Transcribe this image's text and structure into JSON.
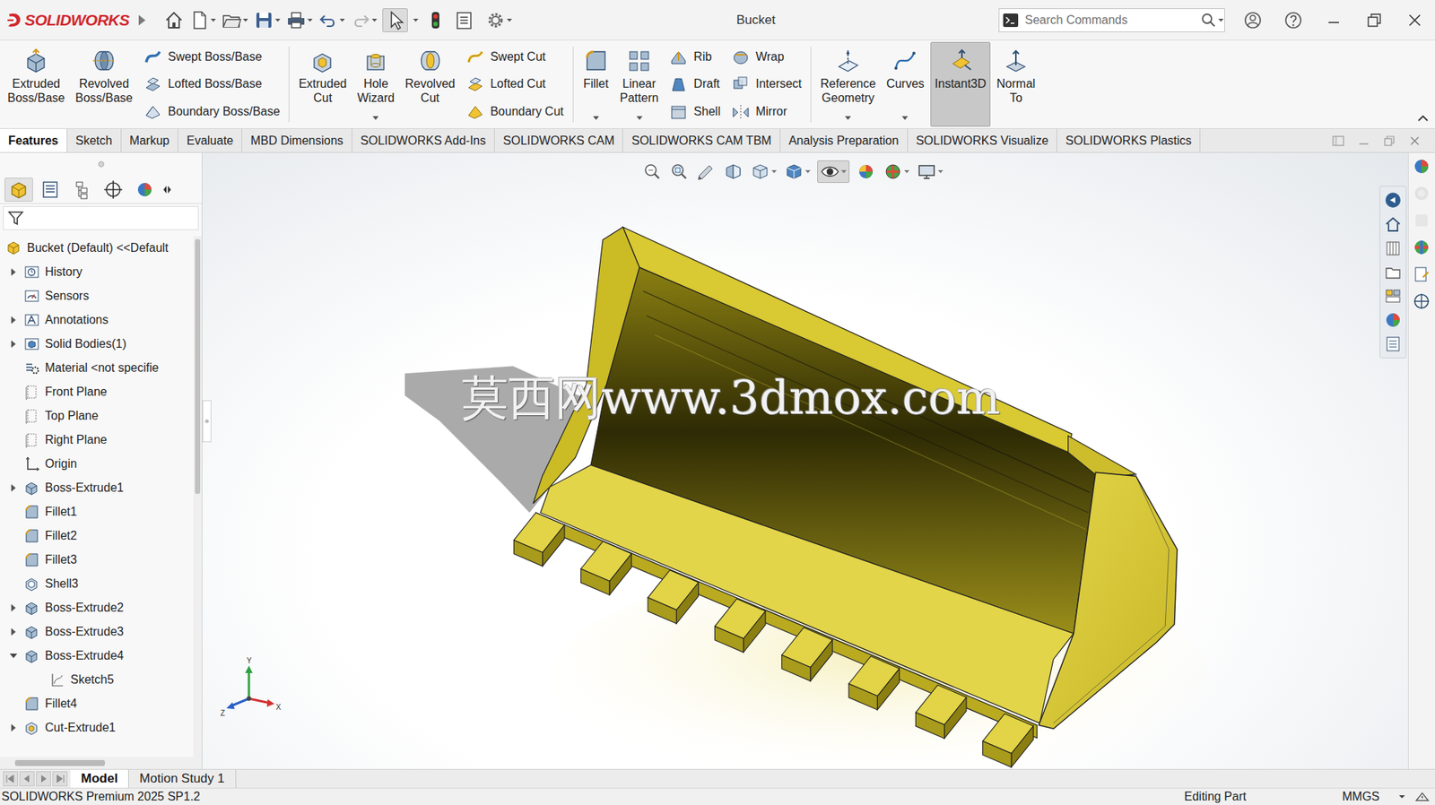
{
  "app": {
    "brand": "SOLIDWORKS"
  },
  "window": {
    "title": "Bucket"
  },
  "search": {
    "placeholder": "Search Commands"
  },
  "ribbon": {
    "groups": [
      {
        "items": [
          {
            "kind": "large",
            "label": "Extruded Boss/Base",
            "selected": false,
            "dropdown": false
          },
          {
            "kind": "large",
            "label": "Revolved Boss/Base",
            "selected": false,
            "dropdown": false
          },
          {
            "kind": "column",
            "entries": [
              "Swept Boss/Base",
              "Lofted Boss/Base",
              "Boundary Boss/Base"
            ]
          }
        ]
      },
      {
        "items": [
          {
            "kind": "large",
            "label": "Extruded Cut",
            "selected": false,
            "dropdown": false
          },
          {
            "kind": "large",
            "label": "Hole Wizard",
            "selected": false,
            "dropdown": true
          },
          {
            "kind": "large",
            "label": "Revolved Cut",
            "selected": false,
            "dropdown": false
          },
          {
            "kind": "column",
            "entries": [
              "Swept Cut",
              "Lofted Cut",
              "Boundary Cut"
            ]
          }
        ]
      },
      {
        "items": [
          {
            "kind": "large",
            "label": "Fillet",
            "selected": false,
            "dropdown": true
          },
          {
            "kind": "large",
            "label": "Linear Pattern",
            "selected": false,
            "dropdown": true
          },
          {
            "kind": "column",
            "entries": [
              "Rib",
              "Draft",
              "Shell"
            ]
          },
          {
            "kind": "column",
            "entries": [
              "Wrap",
              "Intersect",
              "Mirror"
            ]
          }
        ]
      },
      {
        "items": [
          {
            "kind": "large",
            "label": "Reference Geometry",
            "selected": false,
            "dropdown": true
          },
          {
            "kind": "large",
            "label": "Curves",
            "selected": false,
            "dropdown": true
          },
          {
            "kind": "large",
            "label": "Instant3D",
            "selected": true,
            "dropdown": false
          },
          {
            "kind": "large",
            "label": "Normal To",
            "selected": false,
            "dropdown": false
          }
        ]
      }
    ]
  },
  "tabs": [
    {
      "label": "Features",
      "selected": true
    },
    {
      "label": "Sketch",
      "selected": false
    },
    {
      "label": "Markup",
      "selected": false
    },
    {
      "label": "Evaluate",
      "selected": false
    },
    {
      "label": "MBD Dimensions",
      "selected": false
    },
    {
      "label": "SOLIDWORKS Add-Ins",
      "selected": false
    },
    {
      "label": "SOLIDWORKS CAM",
      "selected": false
    },
    {
      "label": "SOLIDWORKS CAM TBM",
      "selected": false
    },
    {
      "label": "Analysis Preparation",
      "selected": false
    },
    {
      "label": "SOLIDWORKS Visualize",
      "selected": false
    },
    {
      "label": "SOLIDWORKS Plastics",
      "selected": false
    }
  ],
  "tree": {
    "items": [
      {
        "label": "Bucket (Default) <<Default",
        "depth": 0,
        "expandable": false,
        "expanded": false,
        "kind": "part"
      },
      {
        "label": "History",
        "depth": 1,
        "expandable": true,
        "expanded": false,
        "kind": "history"
      },
      {
        "label": "Sensors",
        "depth": 1,
        "expandable": false,
        "expanded": false,
        "kind": "sensor"
      },
      {
        "label": "Annotations",
        "depth": 1,
        "expandable": true,
        "expanded": false,
        "kind": "annotation"
      },
      {
        "label": "Solid Bodies(1)",
        "depth": 1,
        "expandable": true,
        "expanded": false,
        "kind": "solid"
      },
      {
        "label": "Material <not specifie",
        "depth": 1,
        "expandable": false,
        "expanded": false,
        "kind": "material"
      },
      {
        "label": "Front Plane",
        "depth": 1,
        "expandable": false,
        "expanded": false,
        "kind": "plane"
      },
      {
        "label": "Top Plane",
        "depth": 1,
        "expandable": false,
        "expanded": false,
        "kind": "plane"
      },
      {
        "label": "Right Plane",
        "depth": 1,
        "expandable": false,
        "expanded": false,
        "kind": "plane"
      },
      {
        "label": "Origin",
        "depth": 1,
        "expandable": false,
        "expanded": false,
        "kind": "origin"
      },
      {
        "label": "Boss-Extrude1",
        "depth": 1,
        "expandable": true,
        "expanded": false,
        "kind": "extrude"
      },
      {
        "label": "Fillet1",
        "depth": 1,
        "expandable": false,
        "expanded": false,
        "kind": "fillet"
      },
      {
        "label": "Fillet2",
        "depth": 1,
        "expandable": false,
        "expanded": false,
        "kind": "fillet"
      },
      {
        "label": "Fillet3",
        "depth": 1,
        "expandable": false,
        "expanded": false,
        "kind": "fillet"
      },
      {
        "label": "Shell3",
        "depth": 1,
        "expandable": false,
        "expanded": false,
        "kind": "shell"
      },
      {
        "label": "Boss-Extrude2",
        "depth": 1,
        "expandable": true,
        "expanded": false,
        "kind": "extrude"
      },
      {
        "label": "Boss-Extrude3",
        "depth": 1,
        "expandable": true,
        "expanded": false,
        "kind": "extrude"
      },
      {
        "label": "Boss-Extrude4",
        "depth": 1,
        "expandable": true,
        "expanded": true,
        "kind": "extrude"
      },
      {
        "label": "Sketch5",
        "depth": 2,
        "expandable": false,
        "expanded": false,
        "kind": "sketch"
      },
      {
        "label": "Fillet4",
        "depth": 1,
        "expandable": false,
        "expanded": false,
        "kind": "fillet"
      },
      {
        "label": "Cut-Extrude1",
        "depth": 1,
        "expandable": true,
        "expanded": false,
        "kind": "cut"
      }
    ]
  },
  "viewport": {
    "watermark": "莫西网www.3dmox.com",
    "triad": {
      "y": "Y",
      "x": "X",
      "z": "Z"
    }
  },
  "bottom_tabs": [
    {
      "label": "Model",
      "selected": true
    },
    {
      "label": "Motion Study 1",
      "selected": false
    }
  ],
  "status_bar": {
    "product": "SOLIDWORKS Premium 2025 SP1.2",
    "mode": "Editing Part",
    "units": "MMGS"
  }
}
